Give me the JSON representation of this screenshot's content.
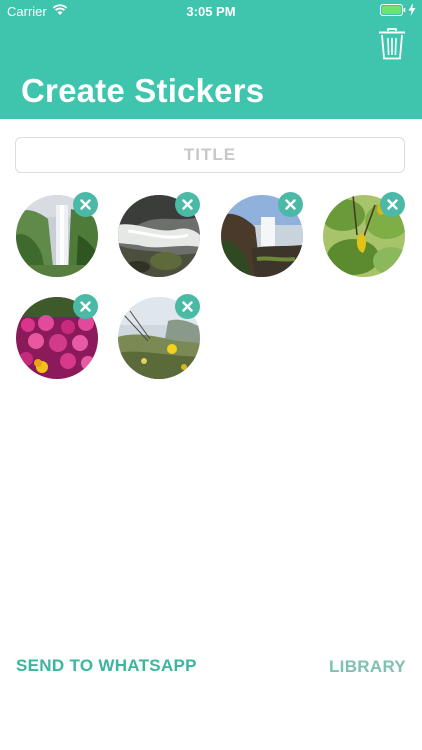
{
  "status_bar": {
    "carrier": "Carrier",
    "time": "3:05 PM"
  },
  "header": {
    "title": "Create Stickers",
    "trash_icon": "trash-icon"
  },
  "title_input": {
    "placeholder": "TITLE",
    "value": ""
  },
  "stickers": [
    {
      "scene": "waterfall-cliff"
    },
    {
      "scene": "rocky-stream"
    },
    {
      "scene": "cliff-waterfall-sea"
    },
    {
      "scene": "yellow-fruit-tree"
    },
    {
      "scene": "pink-flowers"
    },
    {
      "scene": "coastal-flowers"
    }
  ],
  "footer": {
    "send_label": "SEND TO WHATSAPP",
    "library_label": "LIBRARY"
  },
  "colors": {
    "accent": "#3fc4ae",
    "remove_badge": "#4ab9a5",
    "send": "#3ab59f",
    "library": "#7ec0b2"
  }
}
